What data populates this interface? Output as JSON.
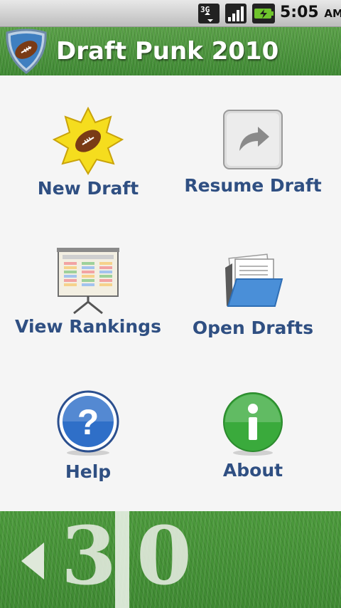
{
  "status_bar": {
    "network": "3G",
    "time": "5:05",
    "ampm": "AM"
  },
  "header": {
    "title": "Draft Punk 2010",
    "logo_icon": "football-shield-icon"
  },
  "menu": {
    "items": [
      {
        "label": "New Draft",
        "icon": "starburst-football-icon"
      },
      {
        "label": "Resume Draft",
        "icon": "redo-arrow-icon"
      },
      {
        "label": "View Rankings",
        "icon": "rankings-board-icon"
      },
      {
        "label": "Open Drafts",
        "icon": "open-folder-icon"
      },
      {
        "label": "Help",
        "icon": "question-icon"
      },
      {
        "label": "About",
        "icon": "info-icon"
      }
    ]
  },
  "field": {
    "yard_tens": "3",
    "yard_ones": "0"
  },
  "colors": {
    "label": "#2f4f82",
    "field_green": "#4c9a3c",
    "background": "#f5f5f5"
  }
}
